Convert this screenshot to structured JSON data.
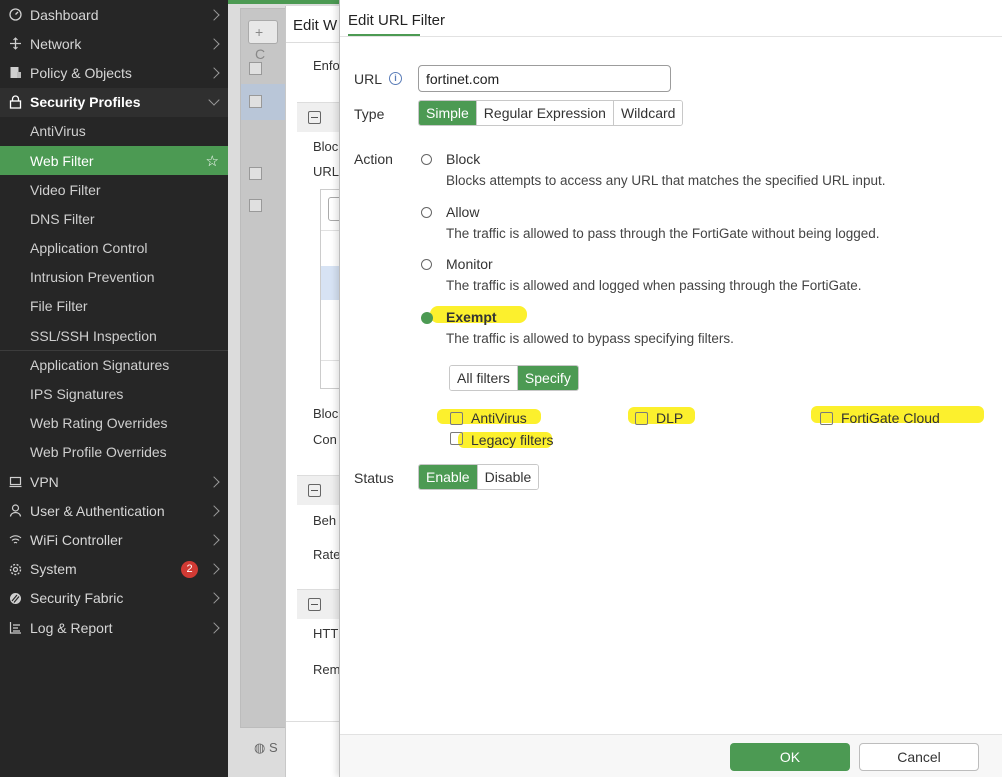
{
  "sidebar": {
    "items": [
      {
        "label": "Dashboard",
        "icon": "dashboard-icon"
      },
      {
        "label": "Network",
        "icon": "network-icon"
      },
      {
        "label": "Policy & Objects",
        "icon": "policy-icon"
      },
      {
        "label": "Security Profiles",
        "icon": "lock-icon"
      }
    ],
    "sub_items": [
      "AntiVirus",
      "Web Filter",
      "Video Filter",
      "DNS Filter",
      "Application Control",
      "Intrusion Prevention",
      "File Filter",
      "SSL/SSH Inspection",
      "Application Signatures",
      "IPS Signatures",
      "Web Rating Overrides",
      "Web Profile Overrides"
    ],
    "active_sub": "Web Filter",
    "bottom_items": [
      {
        "label": "VPN",
        "icon": "monitor-icon"
      },
      {
        "label": "User & Authentication",
        "icon": "user-icon"
      },
      {
        "label": "WiFi Controller",
        "icon": "wifi-icon"
      },
      {
        "label": "System",
        "icon": "gear-icon",
        "badge": "2"
      },
      {
        "label": "Security Fabric",
        "icon": "fabric-icon"
      },
      {
        "label": "Log & Report",
        "icon": "report-icon"
      }
    ]
  },
  "background": {
    "create_button": "+ C",
    "footer_text": "S"
  },
  "profile_modal": {
    "title": "Edit W",
    "labels": [
      "Enfo",
      "Bloc",
      "URL",
      "Bloc",
      "Con",
      "Beh",
      "Rate",
      "HTT",
      "Rem"
    ]
  },
  "url_filter_modal": {
    "title": "Edit URL Filter",
    "url_label": "URL",
    "url_value": "fortinet.com",
    "type_label": "Type",
    "type_options": [
      "Simple",
      "Regular Expression",
      "Wildcard"
    ],
    "type_selected": "Simple",
    "action_label": "Action",
    "actions": [
      {
        "title": "Block",
        "desc": "Blocks attempts to access any URL that matches the specified URL input."
      },
      {
        "title": "Allow",
        "desc": "The traffic is allowed to pass through the FortiGate without being logged."
      },
      {
        "title": "Monitor",
        "desc": "The traffic is allowed and logged when passing through the FortiGate."
      },
      {
        "title": "Exempt",
        "desc": "The traffic is allowed to bypass specifying filters."
      }
    ],
    "action_selected": "Exempt",
    "filter_mode_options": [
      "All filters",
      "Specify"
    ],
    "filter_mode_selected": "Specify",
    "exempt_filters": [
      "AntiVirus",
      "DLP",
      "FortiGate Cloud",
      "Legacy filters"
    ],
    "status_label": "Status",
    "status_options": [
      "Enable",
      "Disable"
    ],
    "status_selected": "Enable",
    "ok_label": "OK",
    "cancel_label": "Cancel"
  },
  "colors": {
    "accent": "#4c9a53",
    "highlight": "#fcf02d",
    "sidebar_bg": "#262626",
    "badge": "#d13a34"
  }
}
